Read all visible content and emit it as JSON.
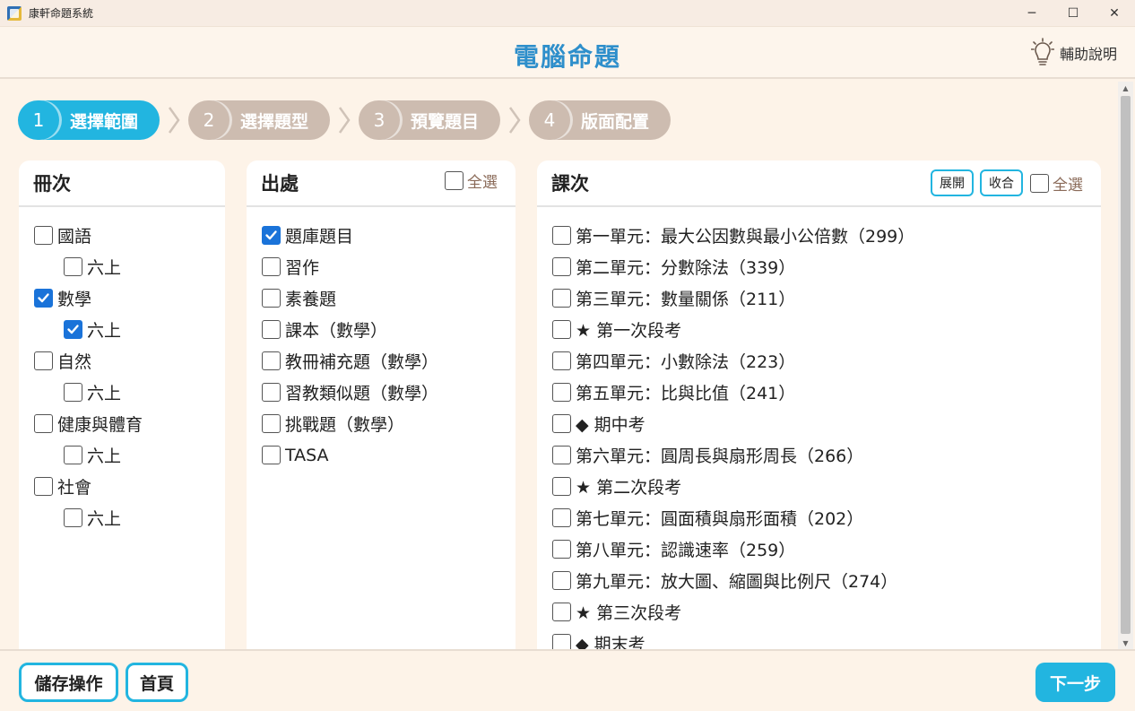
{
  "window": {
    "title": "康軒命題系統",
    "minimize": "─",
    "maximize": "☐",
    "close": "✕"
  },
  "header": {
    "title": "電腦命題",
    "help_label": "輔助說明"
  },
  "steps": [
    {
      "num": "1",
      "label": "選擇範圍",
      "active": true
    },
    {
      "num": "2",
      "label": "選擇題型",
      "active": false
    },
    {
      "num": "3",
      "label": "預覽題目",
      "active": false
    },
    {
      "num": "4",
      "label": "版面配置",
      "active": false
    }
  ],
  "volumes": {
    "title": "冊次",
    "items": [
      {
        "label": "國語",
        "checked": false,
        "indent": false
      },
      {
        "label": "六上",
        "checked": false,
        "indent": true
      },
      {
        "label": "數學",
        "checked": true,
        "indent": false
      },
      {
        "label": "六上",
        "checked": true,
        "indent": true
      },
      {
        "label": "自然",
        "checked": false,
        "indent": false
      },
      {
        "label": "六上",
        "checked": false,
        "indent": true
      },
      {
        "label": "健康與體育",
        "checked": false,
        "indent": false
      },
      {
        "label": "六上",
        "checked": false,
        "indent": true
      },
      {
        "label": "社會",
        "checked": false,
        "indent": false
      },
      {
        "label": "六上",
        "checked": false,
        "indent": true
      }
    ]
  },
  "sources": {
    "title": "出處",
    "select_all": "全選",
    "items": [
      {
        "label": "題庫題目",
        "checked": true
      },
      {
        "label": "習作",
        "checked": false
      },
      {
        "label": "素養題",
        "checked": false
      },
      {
        "label": "課本（數學）",
        "checked": false
      },
      {
        "label": "教冊補充題（數學）",
        "checked": false
      },
      {
        "label": "習教類似題（數學）",
        "checked": false
      },
      {
        "label": "挑戰題（數學）",
        "checked": false
      },
      {
        "label": "TASA",
        "checked": false
      }
    ]
  },
  "lessons": {
    "title": "課次",
    "expand": "展開",
    "collapse": "收合",
    "select_all": "全選",
    "items": [
      {
        "label": "第一單元：最大公因數與最小公倍數（299）",
        "checked": false
      },
      {
        "label": "第二單元：分數除法（339）",
        "checked": false
      },
      {
        "label": "第三單元：數量關係（211）",
        "checked": false
      },
      {
        "label": "★ 第一次段考",
        "checked": false
      },
      {
        "label": "第四單元：小數除法（223）",
        "checked": false
      },
      {
        "label": "第五單元：比與比值（241）",
        "checked": false
      },
      {
        "label": "◆ 期中考",
        "checked": false
      },
      {
        "label": "第六單元：圓周長與扇形周長（266）",
        "checked": false
      },
      {
        "label": "★ 第二次段考",
        "checked": false
      },
      {
        "label": "第七單元：圓面積與扇形面積（202）",
        "checked": false
      },
      {
        "label": "第八單元：認識速率（259）",
        "checked": false
      },
      {
        "label": "第九單元：放大圖、縮圖與比例尺（274）",
        "checked": false
      },
      {
        "label": "★ 第三次段考",
        "checked": false
      },
      {
        "label": "◆ 期末考",
        "checked": false
      }
    ]
  },
  "footer": {
    "save_label": "儲存操作",
    "home_label": "首頁",
    "next_label": "下一步"
  },
  "colors": {
    "accent": "#22b5e0",
    "title": "#2e8fcb",
    "inactive_step": "#cdbcb0",
    "check": "#1a73d9",
    "background": "#fdf3e8"
  }
}
